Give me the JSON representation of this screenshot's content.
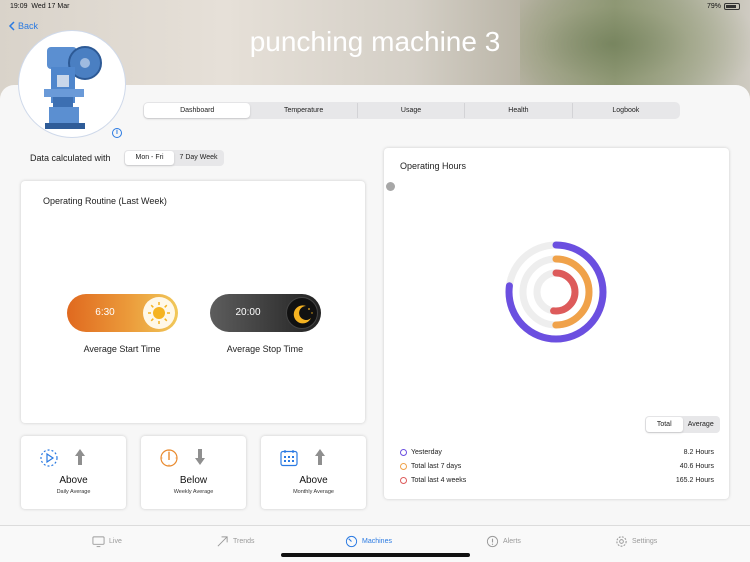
{
  "status_bar": {
    "time": "19:09",
    "date": "Wed 17 Mar",
    "battery": "79%"
  },
  "nav": {
    "back_label": "Back"
  },
  "page_title": "punching machine 3",
  "segments": [
    "Dashboard",
    "Temperature",
    "Usage",
    "Health",
    "Logbook"
  ],
  "selected_segment": "Dashboard",
  "calc": {
    "label": "Data calculated with",
    "options": [
      "Mon - Fri",
      "7 Day Week"
    ],
    "selected": "Mon - Fri"
  },
  "routine": {
    "title": "Operating Routine (Last Week)",
    "start": {
      "value": "6:30",
      "caption": "Average Start Time",
      "icon": "sun-icon"
    },
    "stop": {
      "value": "20:00",
      "caption": "Average Stop Time",
      "icon": "moon-icon"
    }
  },
  "averages": [
    {
      "status": "Above",
      "period": "Daily Average",
      "icon": "play-clock-icon",
      "direction": "up"
    },
    {
      "status": "Below",
      "period": "Weekly Average",
      "icon": "compass-icon",
      "direction": "down"
    },
    {
      "status": "Above",
      "period": "Monthly Average",
      "icon": "calendar-icon",
      "direction": "up"
    }
  ],
  "hours": {
    "title": "Operating Hours",
    "toggle": [
      "Total",
      "Average"
    ],
    "toggle_selected": "Total",
    "legend": [
      {
        "label": "Yesterday",
        "value": "8.2 Hours",
        "color": "#6b4fe0"
      },
      {
        "label": "Total last 7 days",
        "value": "40.6 Hours",
        "color": "#f0a24a"
      },
      {
        "label": "Total last 4 weeks",
        "value": "165.2 Hours",
        "color": "#dd5b5b"
      }
    ],
    "ring_fractions": [
      0.77,
      0.5,
      0.52
    ]
  },
  "tabs": [
    {
      "label": "Live",
      "icon": "monitor-icon"
    },
    {
      "label": "Trends",
      "icon": "trend-arrow-icon"
    },
    {
      "label": "Machines",
      "icon": "gauge-icon"
    },
    {
      "label": "Alerts",
      "icon": "alert-icon"
    },
    {
      "label": "Settings",
      "icon": "gear-icon"
    }
  ],
  "active_tab": "Machines",
  "colors": {
    "accent": "#2a7ae2"
  }
}
